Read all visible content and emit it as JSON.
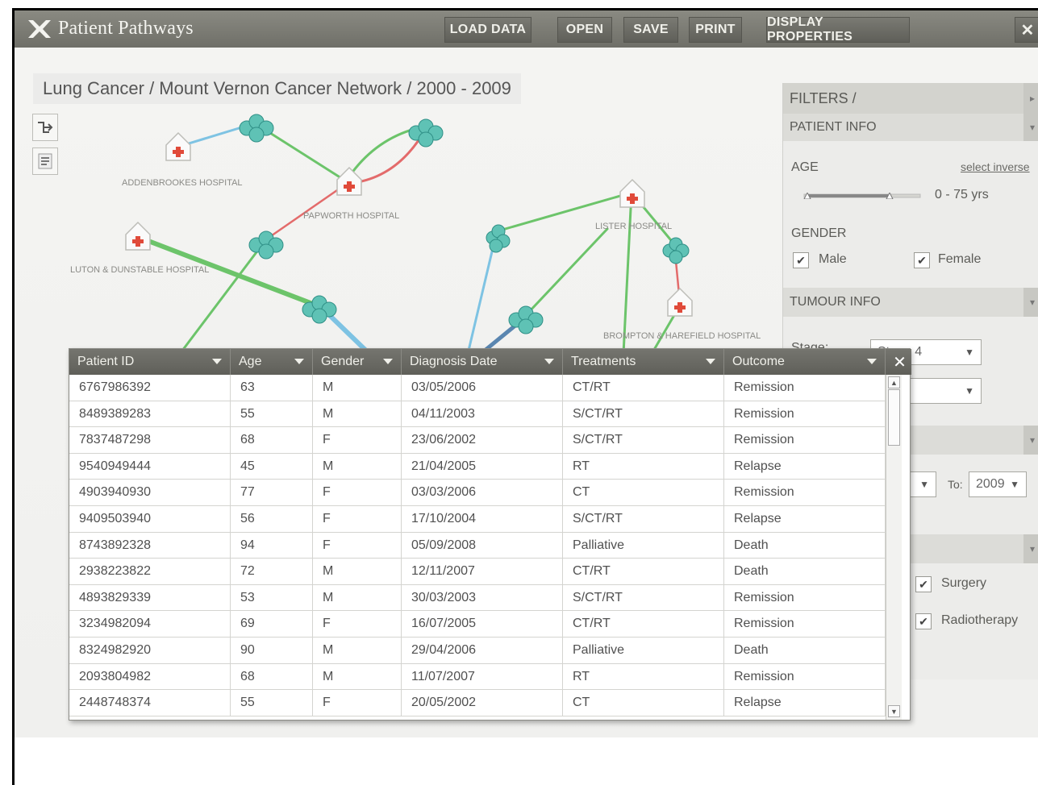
{
  "app": {
    "title": "Patient Pathways"
  },
  "toolbar": {
    "load_data": "LOAD DATA",
    "open": "OPEN",
    "save": "SAVE",
    "print": "PRINT",
    "display_properties": "DISPLAY PROPERTIES",
    "close": "✕"
  },
  "breadcrumb": "Lung Cancer / Mount Vernon Cancer Network / 2000 - 2009",
  "network": {
    "hospitals": [
      "ADDENBROOKES HOSPITAL",
      "PAPWORTH HOSPITAL",
      "LUTON & DUNSTABLE HOSPITAL",
      "LISTER HOSPITAL",
      "BROMPTON & HAREFIELD HOSPITAL"
    ]
  },
  "filters": {
    "title": "FILTERS /",
    "patient_info": {
      "title": "PATIENT INFO",
      "age_label": "AGE",
      "select_inverse": "select inverse",
      "age_range": "0 - 75 yrs",
      "gender_label": "GENDER",
      "male": "Male",
      "female": "Female"
    },
    "tumour_info": {
      "title": "TUMOUR INFO",
      "stage_label": "Stage:",
      "stage_value": "Stage 4"
    },
    "date": {
      "to_label": "To:",
      "to_value": "2009"
    },
    "treatments": {
      "surgery": "Surgery",
      "radiotherapy": "Radiotherapy"
    }
  },
  "table": {
    "columns": [
      "Patient ID",
      "Age",
      "Gender",
      "Diagnosis Date",
      "Treatments",
      "Outcome"
    ],
    "rows": [
      [
        "6767986392",
        "63",
        "M",
        "03/05/2006",
        "CT/RT",
        "Remission"
      ],
      [
        "8489389283",
        "55",
        "M",
        "04/11/2003",
        "S/CT/RT",
        "Remission"
      ],
      [
        "7837487298",
        "68",
        "F",
        "23/06/2002",
        "S/CT/RT",
        "Remission"
      ],
      [
        "9540949444",
        "45",
        "M",
        "21/04/2005",
        "RT",
        "Relapse"
      ],
      [
        "4903940930",
        "77",
        "F",
        "03/03/2006",
        "CT",
        "Remission"
      ],
      [
        "9409503940",
        "56",
        "F",
        "17/10/2004",
        "S/CT/RT",
        "Relapse"
      ],
      [
        "8743892328",
        "94",
        "F",
        "05/09/2008",
        "Palliative",
        "Death"
      ],
      [
        "2938223822",
        "72",
        "M",
        "12/11/2007",
        "CT/RT",
        "Death"
      ],
      [
        "4893829339",
        "53",
        "M",
        "30/03/2003",
        "S/CT/RT",
        "Remission"
      ],
      [
        "3234982094",
        "69",
        "F",
        "16/07/2005",
        "CT/RT",
        "Remission"
      ],
      [
        "8324982920",
        "90",
        "M",
        "29/04/2006",
        "Palliative",
        "Death"
      ],
      [
        "2093804982",
        "68",
        "M",
        "11/07/2007",
        "RT",
        "Remission"
      ],
      [
        "2448748374",
        "55",
        "F",
        "20/05/2002",
        "CT",
        "Relapse"
      ]
    ]
  },
  "colors": {
    "green_link": "#6cc46a",
    "blue_link": "#7ec3e3",
    "red_link": "#e36b6b",
    "cluster": "#5fc2b5",
    "hospital_cross": "#e04a3a"
  }
}
